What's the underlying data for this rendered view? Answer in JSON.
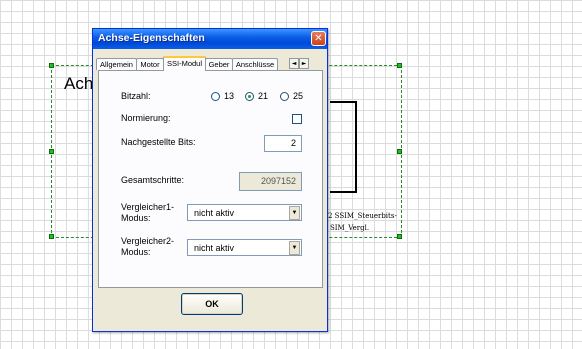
{
  "diagram": {
    "block_title": "Ach",
    "port_label_1": "2  SSIM_Steuerbits-",
    "port_label_2": "SIM_Vergl."
  },
  "dialog": {
    "title": "Achse-Eigenschaften",
    "close_glyph": "✕",
    "tabs": [
      {
        "label": "Allgemein",
        "active": false
      },
      {
        "label": "Motor",
        "active": false
      },
      {
        "label": "SSI-Modul",
        "active": true
      },
      {
        "label": "Geber",
        "active": false
      },
      {
        "label": "Anschlüsse",
        "active": false
      }
    ],
    "tab_scroll_left": "◄",
    "tab_scroll_right": "►",
    "bitzahl": {
      "label": "Bitzahl:",
      "options": [
        "13",
        "21",
        "25"
      ],
      "selected": "21"
    },
    "normierung": {
      "label": "Normierung:",
      "checked": false
    },
    "nachgestellte_bits": {
      "label": "Nachgestellte Bits:",
      "value": "2"
    },
    "gesamtschritte": {
      "label": "Gesamtschritte:",
      "value": "2097152"
    },
    "vergleicher1": {
      "label_line1": "Vergleicher1-",
      "label_line2": "Modus:",
      "value": "nicht aktiv"
    },
    "vergleicher2": {
      "label_line1": "Vergleicher2-",
      "label_line2": "Modus:",
      "value": "nicht aktiv"
    },
    "ok_label": "OK",
    "dropdown_glyph": "▼"
  },
  "colors": {
    "titlebar": "#0a5fe8",
    "selection": "#2a8a2a",
    "dialog_face": "#ece9d8"
  }
}
